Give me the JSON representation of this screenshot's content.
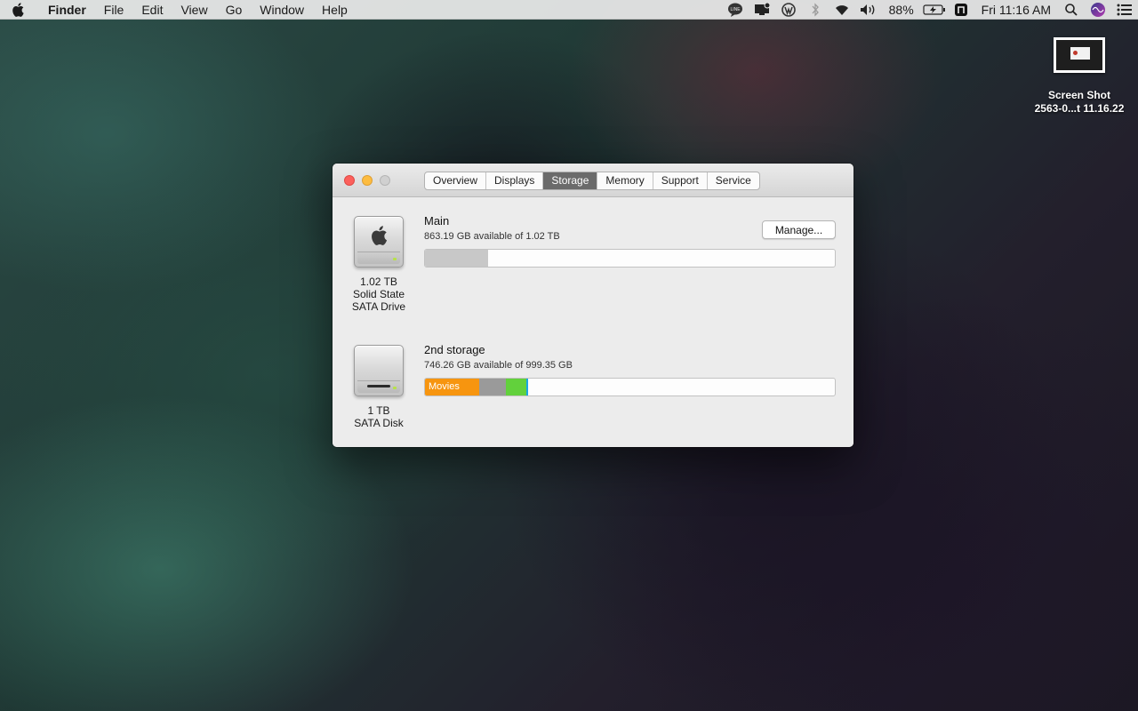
{
  "menubar": {
    "app_name": "Finder",
    "menus": [
      "File",
      "Edit",
      "View",
      "Go",
      "Window",
      "Help"
    ],
    "battery": "88%",
    "clock": "Fri 11:16 AM",
    "status_icons": [
      "line-icon",
      "notification-display-icon",
      "wordpress-icon",
      "bluetooth-icon",
      "wifi-icon",
      "volume-icon",
      "battery-charging-icon",
      "n-app-icon",
      "search-icon",
      "siri-icon",
      "notification-center-icon"
    ]
  },
  "desktop": {
    "icon_label_line1": "Screen Shot",
    "icon_label_line2": "2563-0...t 11.16.22"
  },
  "window": {
    "tabs": [
      {
        "label": "Overview",
        "active": false
      },
      {
        "label": "Displays",
        "active": false
      },
      {
        "label": "Storage",
        "active": true
      },
      {
        "label": "Memory",
        "active": false
      },
      {
        "label": "Support",
        "active": false
      },
      {
        "label": "Service",
        "active": false
      }
    ],
    "manage_label": "Manage...",
    "drives": [
      {
        "name": "Main",
        "available": "863.19 GB available of 1.02 TB",
        "caption": [
          "1.02 TB",
          "Solid State",
          "SATA Drive"
        ],
        "used_fraction": 0.153
      },
      {
        "name": "2nd storage",
        "available": "746.26 GB available of 999.35 GB",
        "caption": [
          "1 TB",
          "SATA Disk"
        ],
        "segments": [
          {
            "label": "Movies",
            "fraction": 0.132,
            "color": "#f7950f"
          },
          {
            "label": "",
            "fraction": 0.065,
            "color": "#9a9a9a"
          },
          {
            "label": "",
            "fraction": 0.051,
            "color": "#62d13c"
          },
          {
            "label": "",
            "fraction": 0.004,
            "color": "#1ba6e6"
          }
        ]
      }
    ]
  }
}
